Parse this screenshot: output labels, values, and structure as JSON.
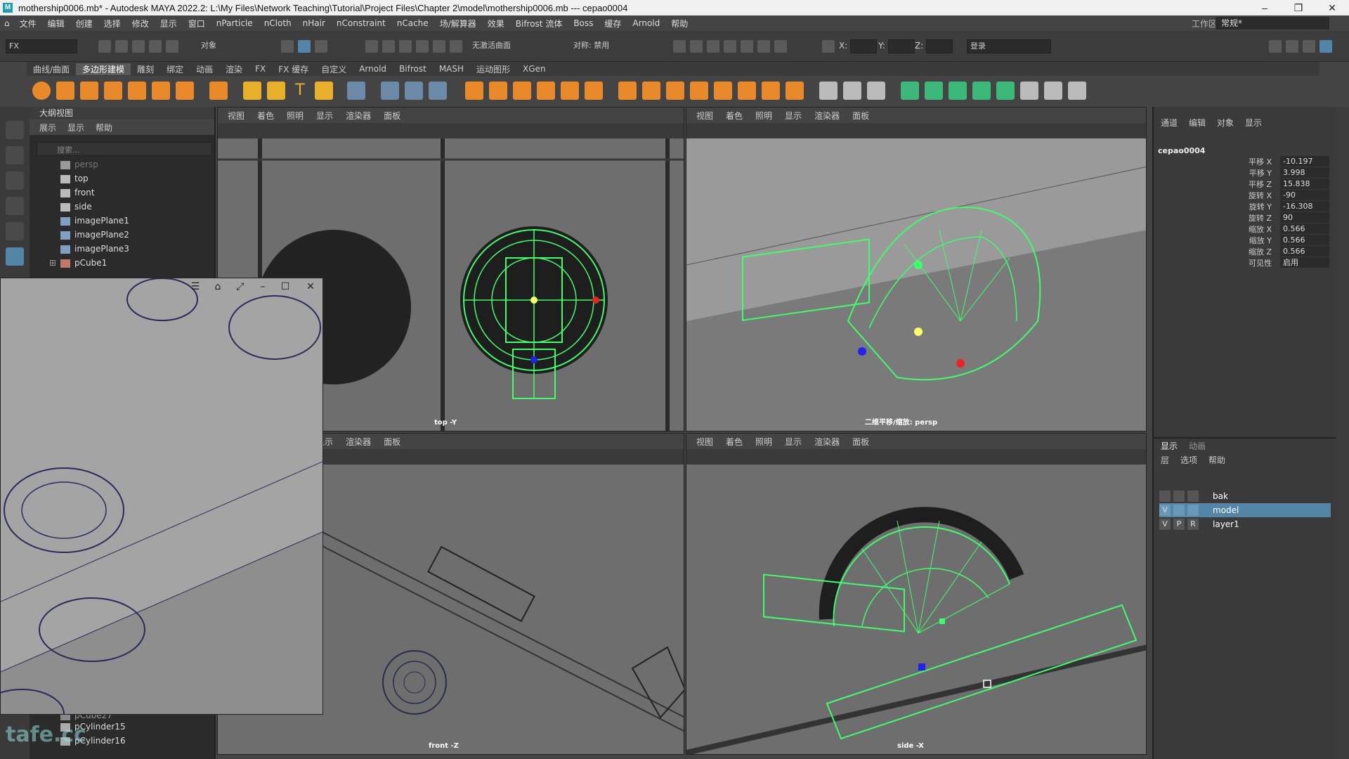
{
  "titlebar": {
    "text": "mothership0006.mb* - Autodesk MAYA 2022.2: L:\\My Files\\Network Teaching\\Tutorial\\Project Files\\Chapter 2\\model\\mothership0006.mb  ---  cepao0004"
  },
  "menu": {
    "items": [
      "文件",
      "编辑",
      "创建",
      "选择",
      "修改",
      "显示",
      "窗口",
      "nParticle",
      "nCloth",
      "nHair",
      "nConstraint",
      "nCache",
      "场/解算器",
      "效果",
      "Bifrost 流体",
      "Boss",
      "缓存",
      "Arnold",
      "帮助"
    ]
  },
  "statusline": {
    "menuset": "FX",
    "select_mode": "对象",
    "live_surface": "无激活曲面",
    "symmetry": "对称: 禁用",
    "x_label": "X:",
    "y_label": "Y:",
    "z_label": "Z:",
    "login": "登录",
    "workspace_label": "工作区:",
    "workspace_value": "常规*"
  },
  "shelf": {
    "tabs": [
      "曲线/曲面",
      "多边形建模",
      "雕刻",
      "绑定",
      "动画",
      "渲染",
      "FX",
      "FX 缓存",
      "自定义",
      "Arnold",
      "Bifrost",
      "MASH",
      "运动图形",
      "XGen"
    ],
    "active_tab": "多边形建模"
  },
  "outliner": {
    "title": "大纲视图",
    "menu": [
      "展示",
      "显示",
      "帮助"
    ],
    "search_placeholder": "搜索...",
    "items": [
      "persp",
      "top",
      "front",
      "side",
      "imagePlane1",
      "imagePlane2",
      "imagePlane3",
      "pCube1"
    ],
    "bottom_items": [
      "pCube27",
      "pCylinder15",
      "pCylinder16"
    ]
  },
  "viewports": {
    "menu": [
      "视图",
      "着色",
      "照明",
      "显示",
      "渲染器",
      "面板"
    ],
    "top_label": "top -Y",
    "persp_label": "二维平移/缩放: persp",
    "front_label": "front -Z",
    "side_label": "side -X"
  },
  "channelbox": {
    "menu": [
      "通道",
      "编辑",
      "对象",
      "显示"
    ],
    "object": "cepao0004",
    "attributes": [
      {
        "label": "平移 X",
        "value": "-10.197"
      },
      {
        "label": "平移 Y",
        "value": "3.998"
      },
      {
        "label": "平移 Z",
        "value": "15.838"
      },
      {
        "label": "旋转 X",
        "value": "-90"
      },
      {
        "label": "旋转 Y",
        "value": "-16.308"
      },
      {
        "label": "旋转 Z",
        "value": "90"
      },
      {
        "label": "缩放 X",
        "value": "0.566"
      },
      {
        "label": "缩放 Y",
        "value": "0.566"
      },
      {
        "label": "缩放 Z",
        "value": "0.566"
      },
      {
        "label": "可见性",
        "value": "启用"
      }
    ]
  },
  "layers": {
    "tabs": [
      "显示",
      "动画"
    ],
    "menu": [
      "层",
      "选项",
      "帮助"
    ],
    "rows": [
      {
        "v": "",
        "p": "",
        "r": "",
        "name": "bak",
        "selected": false
      },
      {
        "v": "V",
        "p": "",
        "r": "",
        "name": "model",
        "selected": true
      },
      {
        "v": "V",
        "p": "P",
        "r": "R",
        "name": "layer1",
        "selected": false
      }
    ]
  },
  "watermark": "tafe.cc",
  "colors": {
    "wire": "#3dff6a",
    "selection": "#5285a6"
  }
}
